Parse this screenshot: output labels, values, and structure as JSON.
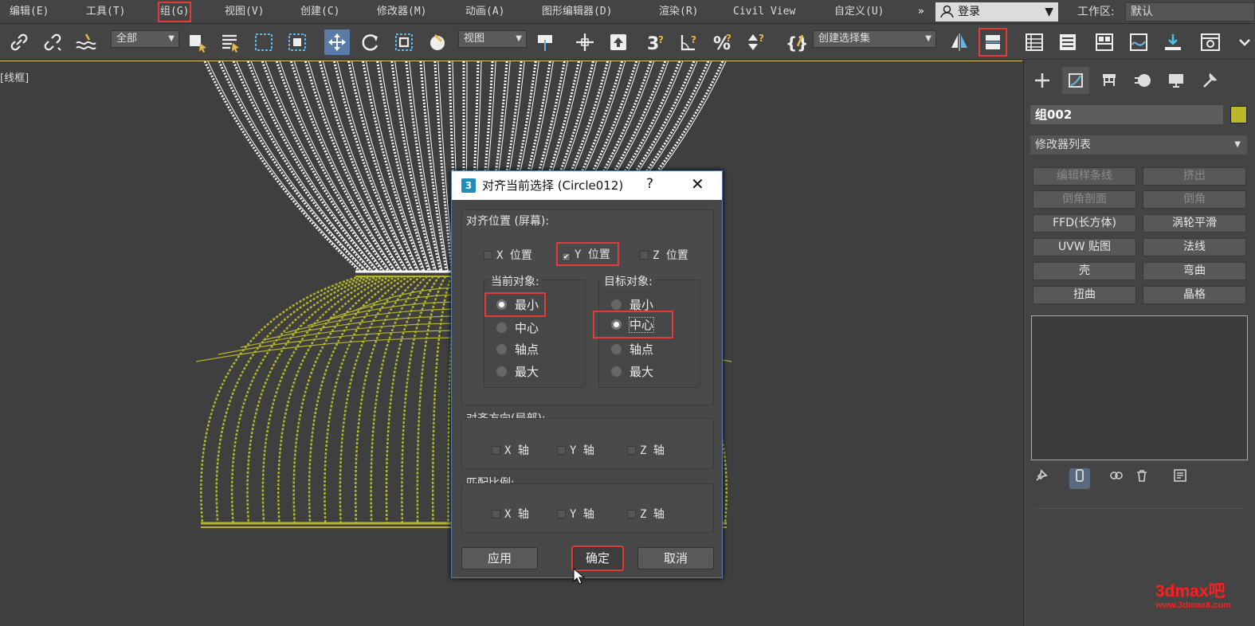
{
  "menubar": {
    "items": [
      "编辑(E)",
      "工具(T)",
      "组(G)",
      "视图(V)",
      "创建(C)",
      "修改器(M)",
      "动画(A)",
      "图形编辑器(D)",
      "渲染(R)",
      "Civil View",
      "自定义(U)"
    ],
    "overflow": "»",
    "login": "登录",
    "workspace_label": "工作区:",
    "workspace_value": "默认"
  },
  "toolbar": {
    "selection_filter": "全部",
    "ref_coord": "视图",
    "named_selection": "创建选择集"
  },
  "viewport": {
    "label": "[线框]",
    "colors": {
      "object_white": "#ffffff",
      "object_yellow": "#b5b52a"
    }
  },
  "command_panel": {
    "object_name": "组002",
    "object_color": "#b9b92a",
    "modifier_list": "修改器列表",
    "modifier_buttons": [
      "编辑样条线",
      "挤出",
      "倒角剖面",
      "倒角",
      "FFD(长方体)",
      "涡轮平滑",
      "UVW 贴图",
      "法线",
      "壳",
      "弯曲",
      "扭曲",
      "晶格"
    ],
    "disabled_buttons": [
      "编辑样条线",
      "挤出",
      "倒角剖面",
      "倒角"
    ]
  },
  "dialog": {
    "app_icon": "3",
    "title": "对齐当前选择 (Circle012)",
    "help": "?",
    "close": "✕",
    "align_position": {
      "label": "对齐位置 (屏幕):",
      "x": "X 位置",
      "y": "Y 位置",
      "z": "Z 位置",
      "x_checked": false,
      "y_checked": true,
      "z_checked": false
    },
    "current_object": {
      "label": "当前对象:",
      "options": [
        "最小",
        "中心",
        "轴点",
        "最大"
      ],
      "selected": "最小"
    },
    "target_object": {
      "label": "目标对象:",
      "options": [
        "最小",
        "中心",
        "轴点",
        "最大"
      ],
      "selected": "中心"
    },
    "align_orientation": {
      "label": "对齐方向(局部):",
      "x": "X 轴",
      "y": "Y 轴",
      "z": "Z 轴"
    },
    "match_scale": {
      "label": "匹配比例:",
      "x": "X 轴",
      "y": "Y 轴",
      "z": "Z 轴"
    },
    "buttons": {
      "apply": "应用",
      "ok": "确定",
      "cancel": "取消"
    }
  },
  "watermark": {
    "brand": "3dmax吧",
    "url": "www.3dmax8.com"
  }
}
